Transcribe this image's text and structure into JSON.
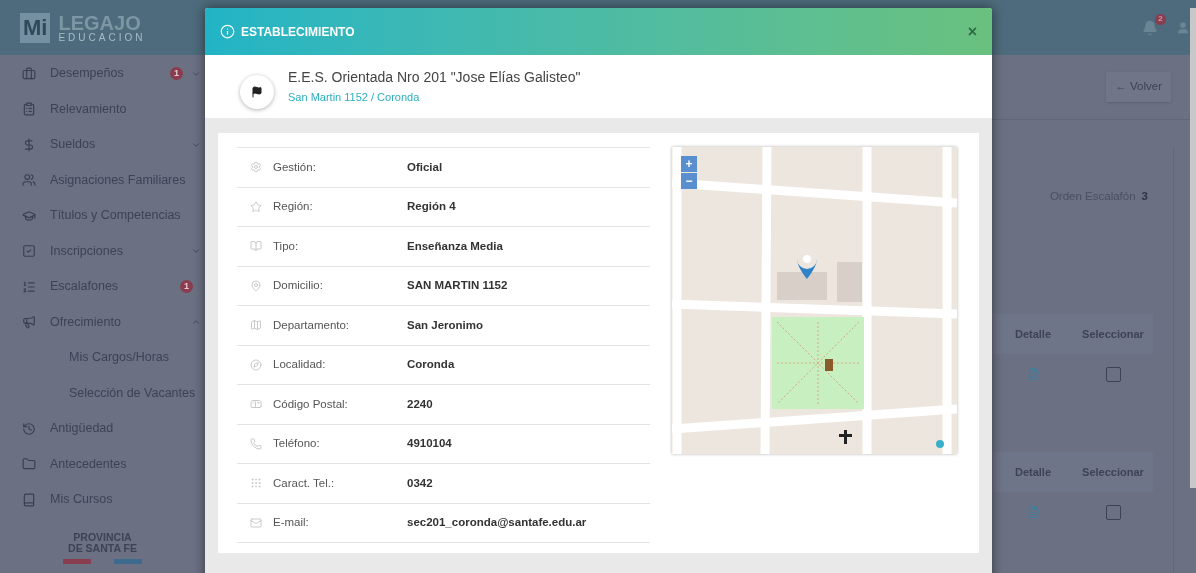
{
  "header": {
    "logo_mark": "Mi",
    "logo_title": "LEGAJO",
    "logo_subtitle": "EDUCACION",
    "notification_count": "2"
  },
  "sidebar": {
    "items": [
      {
        "label": "Desempeños",
        "badge": "1",
        "expanded": false
      },
      {
        "label": "Relevamiento"
      },
      {
        "label": "Sueldos",
        "expanded": false
      },
      {
        "label": "Asignaciones Familiares"
      },
      {
        "label": "Títulos y Competencias"
      },
      {
        "label": "Inscripciones",
        "expanded": false
      },
      {
        "label": "Escalafones",
        "badge": "1"
      },
      {
        "label": "Ofrecimiento",
        "expanded": true,
        "children": [
          {
            "label": "Mis Cargos/Horas"
          },
          {
            "label": "Selección de Vacantes"
          }
        ]
      },
      {
        "label": "Antigüedad"
      },
      {
        "label": "Antecedentes"
      },
      {
        "label": "Mis Cursos"
      }
    ],
    "footer": {
      "line_1": "PROVINCIA",
      "line_2": "DE SANTA FE"
    }
  },
  "page": {
    "back_button": "← Volver",
    "order_label": "Orden Escalafón",
    "order_value": "3",
    "tables": [
      {
        "columns": [
          "Detalle",
          "Seleccionar"
        ],
        "rows": [
          {
            "checked": false
          }
        ]
      },
      {
        "columns": [
          "Detalle",
          "Seleccionar"
        ],
        "rows": [
          {
            "checked": false
          }
        ]
      }
    ]
  },
  "modal": {
    "title": "ESTABLECIMIENTO",
    "close": "×",
    "school_name": "E.E.S. Orientada Nro 201 \"Jose Elías Galisteo\"",
    "school_address": "San Martin 1152 / Coronda",
    "fields": [
      {
        "label": "Gestión:",
        "value": "Oficial"
      },
      {
        "label": "Región:",
        "value": "Región 4"
      },
      {
        "label": "Tipo:",
        "value": "Enseñanza Media"
      },
      {
        "label": "Domicilio:",
        "value": "SAN MARTIN 1152"
      },
      {
        "label": "Departamento:",
        "value": "San Jeronimo"
      },
      {
        "label": "Localidad:",
        "value": "Coronda"
      },
      {
        "label": "Código Postal:",
        "value": "2240"
      },
      {
        "label": "Teléfono:",
        "value": "4910104"
      },
      {
        "label": "Caract. Tel.:",
        "value": "0342"
      },
      {
        "label": "E-mail:",
        "value": "sec201_coronda@santafe.edu.ar"
      }
    ],
    "map": {
      "zoom_in": "+",
      "zoom_out": "−"
    }
  }
}
